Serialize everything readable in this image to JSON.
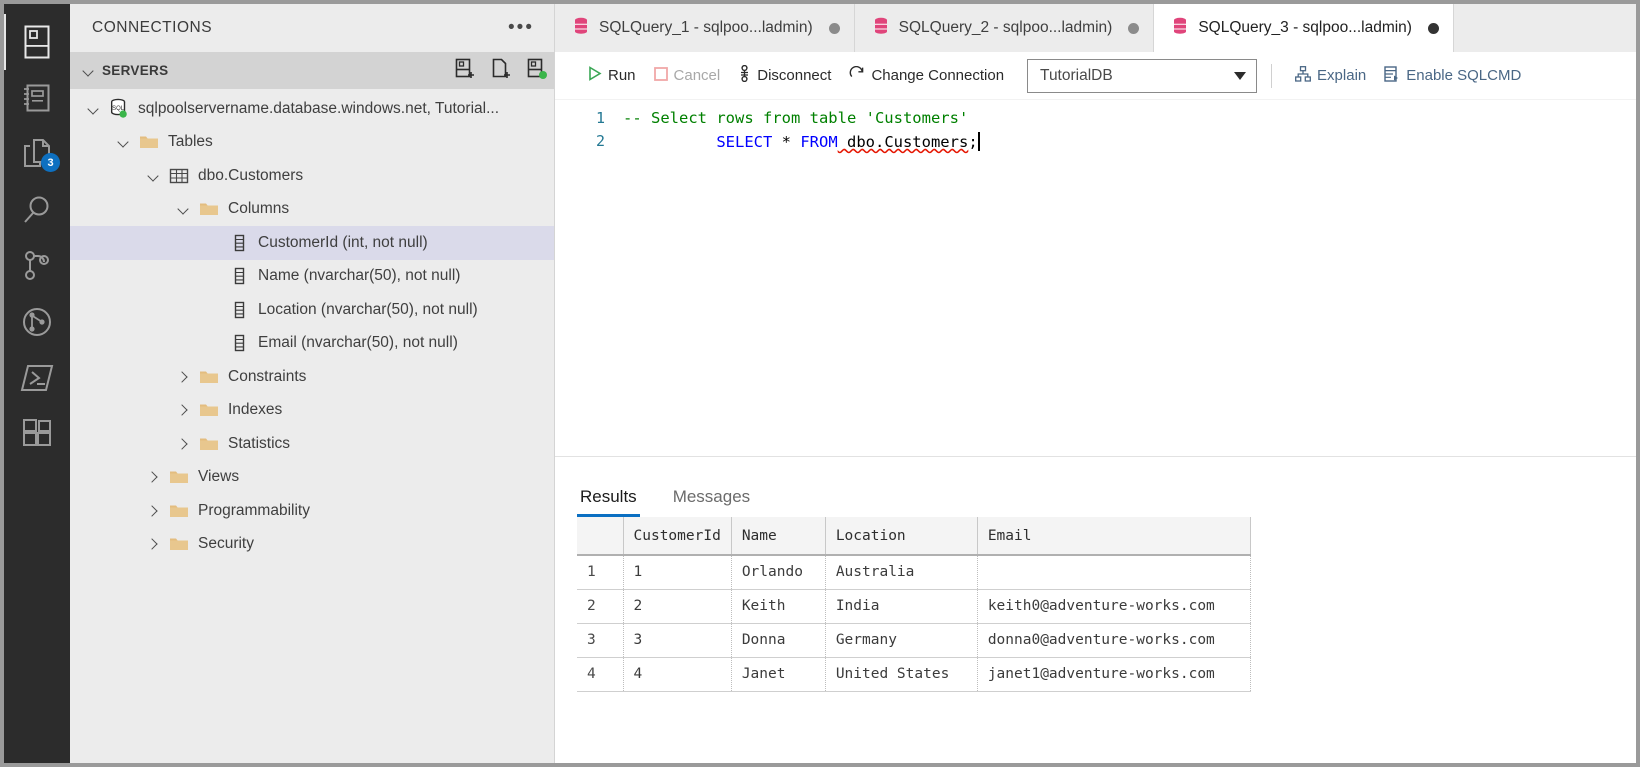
{
  "activity_bar": {
    "items": [
      {
        "name": "connections",
        "icon": "servers-icon",
        "active": true,
        "badge": null
      },
      {
        "name": "notebooks",
        "icon": "notebook-icon",
        "active": false,
        "badge": null
      },
      {
        "name": "open-editors",
        "icon": "files-icon",
        "active": false,
        "badge": "3"
      },
      {
        "name": "search",
        "icon": "search-icon",
        "active": false,
        "badge": null
      },
      {
        "name": "source-control",
        "icon": "source-control-icon",
        "active": false,
        "badge": null
      },
      {
        "name": "deployment",
        "icon": "branch-circle-icon",
        "active": false,
        "badge": null
      },
      {
        "name": "terminal",
        "icon": "powershell-icon",
        "active": false,
        "badge": null
      },
      {
        "name": "extensions",
        "icon": "extensions-icon",
        "active": false,
        "badge": null
      }
    ]
  },
  "sidebar": {
    "title": "CONNECTIONS",
    "more_actions": "•••",
    "section": {
      "label": "SERVERS",
      "tools": [
        "new-connection-icon",
        "new-server-group-icon",
        "connected-server-icon"
      ]
    },
    "tree": [
      {
        "label": "sqlpoolservername.database.windows.net, Tutorial...",
        "indent": 0,
        "twisty": "down",
        "icon": "sql-server-icon",
        "selected": false
      },
      {
        "label": "Tables",
        "indent": 1,
        "twisty": "down",
        "icon": "folder-icon",
        "selected": false
      },
      {
        "label": "dbo.Customers",
        "indent": 2,
        "twisty": "down",
        "icon": "table-icon",
        "selected": false
      },
      {
        "label": "Columns",
        "indent": 3,
        "twisty": "down",
        "icon": "folder-icon",
        "selected": false
      },
      {
        "label": "CustomerId (int, not null)",
        "indent": 4,
        "twisty": "none",
        "icon": "column-icon",
        "selected": true
      },
      {
        "label": "Name (nvarchar(50), not null)",
        "indent": 4,
        "twisty": "none",
        "icon": "column-icon",
        "selected": false
      },
      {
        "label": "Location (nvarchar(50), not null)",
        "indent": 4,
        "twisty": "none",
        "icon": "column-icon",
        "selected": false
      },
      {
        "label": "Email (nvarchar(50), not null)",
        "indent": 4,
        "twisty": "none",
        "icon": "column-icon",
        "selected": false
      },
      {
        "label": "Constraints",
        "indent": 3,
        "twisty": "right",
        "icon": "folder-icon",
        "selected": false
      },
      {
        "label": "Indexes",
        "indent": 3,
        "twisty": "right",
        "icon": "folder-icon",
        "selected": false
      },
      {
        "label": "Statistics",
        "indent": 3,
        "twisty": "right",
        "icon": "folder-icon",
        "selected": false
      },
      {
        "label": "Views",
        "indent": 2,
        "twisty": "right",
        "icon": "folder-icon",
        "selected": false
      },
      {
        "label": "Programmability",
        "indent": 2,
        "twisty": "right",
        "icon": "folder-icon",
        "selected": false
      },
      {
        "label": "Security",
        "indent": 2,
        "twisty": "right",
        "icon": "folder-icon",
        "selected": false
      }
    ]
  },
  "tabs": [
    {
      "label": "SQLQuery_1 - sqlpoo...ladmin)",
      "icon": "database-icon",
      "active": false,
      "dirty": true
    },
    {
      "label": "SQLQuery_2 - sqlpoo...ladmin)",
      "icon": "database-icon",
      "active": false,
      "dirty": true
    },
    {
      "label": "SQLQuery_3 - sqlpoo...ladmin)",
      "icon": "database-icon",
      "active": true,
      "dirty": true
    }
  ],
  "toolbar": {
    "run_label": "Run",
    "cancel_label": "Cancel",
    "disconnect_label": "Disconnect",
    "change_connection_label": "Change Connection",
    "database_value": "TutorialDB",
    "explain_label": "Explain",
    "enable_sqlcmd_label": "Enable SQLCMD",
    "run_color": "#3aa655",
    "cancel_color": "#f0a0a0",
    "link_color": "#4a6785"
  },
  "editor": {
    "lines": [
      {
        "number": "1",
        "comment": "-- Select rows from table 'Customers'"
      },
      {
        "number": "2",
        "kw1": "SELECT",
        "star": " * ",
        "kw2": "FROM",
        "object": " dbo.Customers",
        "semi": ";"
      }
    ]
  },
  "results": {
    "tabs": [
      {
        "label": "Results",
        "active": true
      },
      {
        "label": "Messages",
        "active": false
      }
    ],
    "columns": [
      "CustomerId",
      "Name",
      "Location",
      "Email"
    ],
    "rows": [
      {
        "n": "1",
        "CustomerId": "1",
        "Name": "Orlando",
        "Location": "Australia",
        "Email": ""
      },
      {
        "n": "2",
        "CustomerId": "2",
        "Name": "Keith",
        "Location": "India",
        "Email": "keith0@adventure-works.com"
      },
      {
        "n": "3",
        "CustomerId": "3",
        "Name": "Donna",
        "Location": "Germany",
        "Email": "donna0@adventure-works.com"
      },
      {
        "n": "4",
        "CustomerId": "4",
        "Name": "Janet",
        "Location": "United States",
        "Email": "janet1@adventure-works.com"
      }
    ]
  }
}
